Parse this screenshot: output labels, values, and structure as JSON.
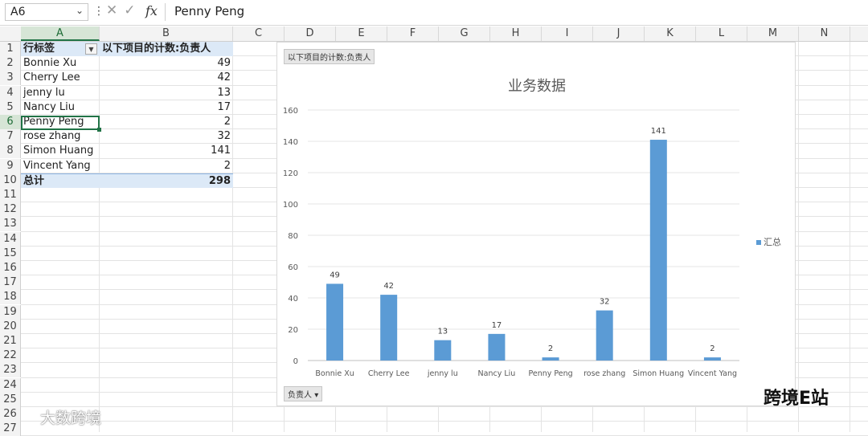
{
  "formula_bar": {
    "name_box": "A6",
    "fx_label": "fx",
    "content": "Penny Peng",
    "cancel_icon": "close-icon",
    "enter_icon": "check-icon"
  },
  "columns": [
    "A",
    "B",
    "C",
    "D",
    "E",
    "F",
    "G",
    "H",
    "I",
    "J",
    "K",
    "L",
    "M",
    "N"
  ],
  "rows": [
    "1",
    "2",
    "3",
    "4",
    "5",
    "6",
    "7",
    "8",
    "9",
    "10",
    "11",
    "12",
    "13",
    "14",
    "15",
    "16",
    "17",
    "18",
    "19",
    "20",
    "21",
    "22",
    "23",
    "24",
    "25",
    "26",
    "27"
  ],
  "pivot": {
    "header_label": "行标签",
    "header_value": "以下项目的计数:负责人",
    "items": [
      {
        "name": "Bonnie Xu",
        "count": "49"
      },
      {
        "name": "Cherry Lee",
        "count": "42"
      },
      {
        "name": "jenny lu",
        "count": "13"
      },
      {
        "name": "Nancy Liu",
        "count": "17"
      },
      {
        "name": "Penny Peng",
        "count": "2"
      },
      {
        "name": "rose zhang",
        "count": "32"
      },
      {
        "name": "Simon Huang",
        "count": "141"
      },
      {
        "name": "Vincent Yang",
        "count": "2"
      }
    ],
    "total_label": "总计",
    "total_value": "298"
  },
  "chart_data": {
    "type": "bar",
    "title": "业务数据",
    "value_field_button": "以下项目的计数:负责人",
    "axis_field_button": "负责人",
    "categories": [
      "Bonnie Xu",
      "Cherry Lee",
      "jenny lu",
      "Nancy Liu",
      "Penny Peng",
      "rose zhang",
      "Simon Huang",
      "Vincent Yang"
    ],
    "series": [
      {
        "name": "汇总",
        "values": [
          49,
          42,
          13,
          17,
          2,
          32,
          141,
          2
        ],
        "color": "#5b9bd5"
      }
    ],
    "yticks": [
      0,
      20,
      40,
      60,
      80,
      100,
      120,
      140,
      160
    ],
    "ylim": [
      0,
      160
    ],
    "grid": true,
    "legend_position": "right",
    "data_labels": true
  },
  "watermarks": {
    "left": "大数跨境",
    "right": "跨境E站"
  },
  "colors": {
    "accent": "#217346",
    "bar": "#5b9bd5",
    "pivot_header_bg": "#dce9f7"
  }
}
